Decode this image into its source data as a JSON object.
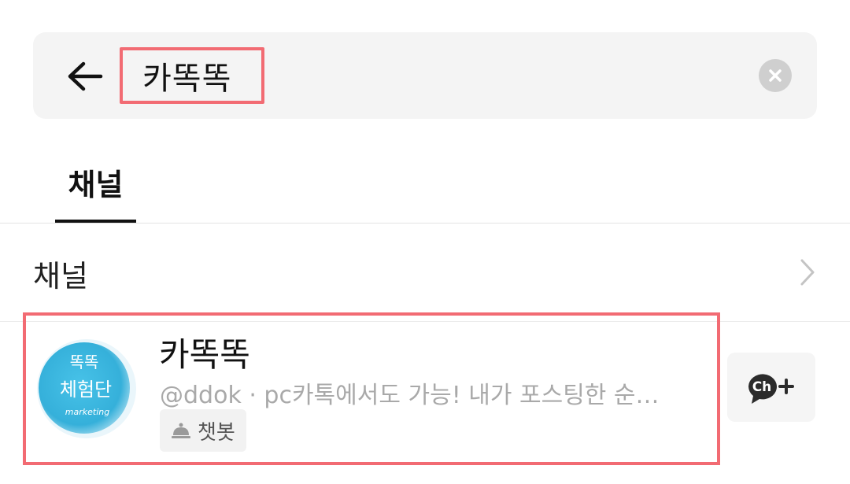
{
  "search": {
    "query": "카똑똑"
  },
  "tabs": [
    {
      "label": "채널",
      "active": true
    }
  ],
  "section": {
    "title": "채널"
  },
  "results": [
    {
      "title": "카똑똑",
      "description": "@ddok · pc카톡에서도 가능! 내가 포스팅한 순…",
      "badge": "챗봇",
      "avatar_text_line1": "똑똑",
      "avatar_text_line2": "체험단",
      "avatar_text_line3": "marketing",
      "add_button_label": "Ch"
    }
  ],
  "colors": {
    "highlight": "#f26b73",
    "avatar_blue": "#3cb6dd",
    "ch_icon": "#2b2b2b"
  },
  "icons": {
    "back": "arrow-left-icon",
    "clear": "close-circle-icon",
    "chevron": "chevron-right-icon",
    "chatbot": "bell-icon",
    "channel_add": "channel-add-icon"
  }
}
